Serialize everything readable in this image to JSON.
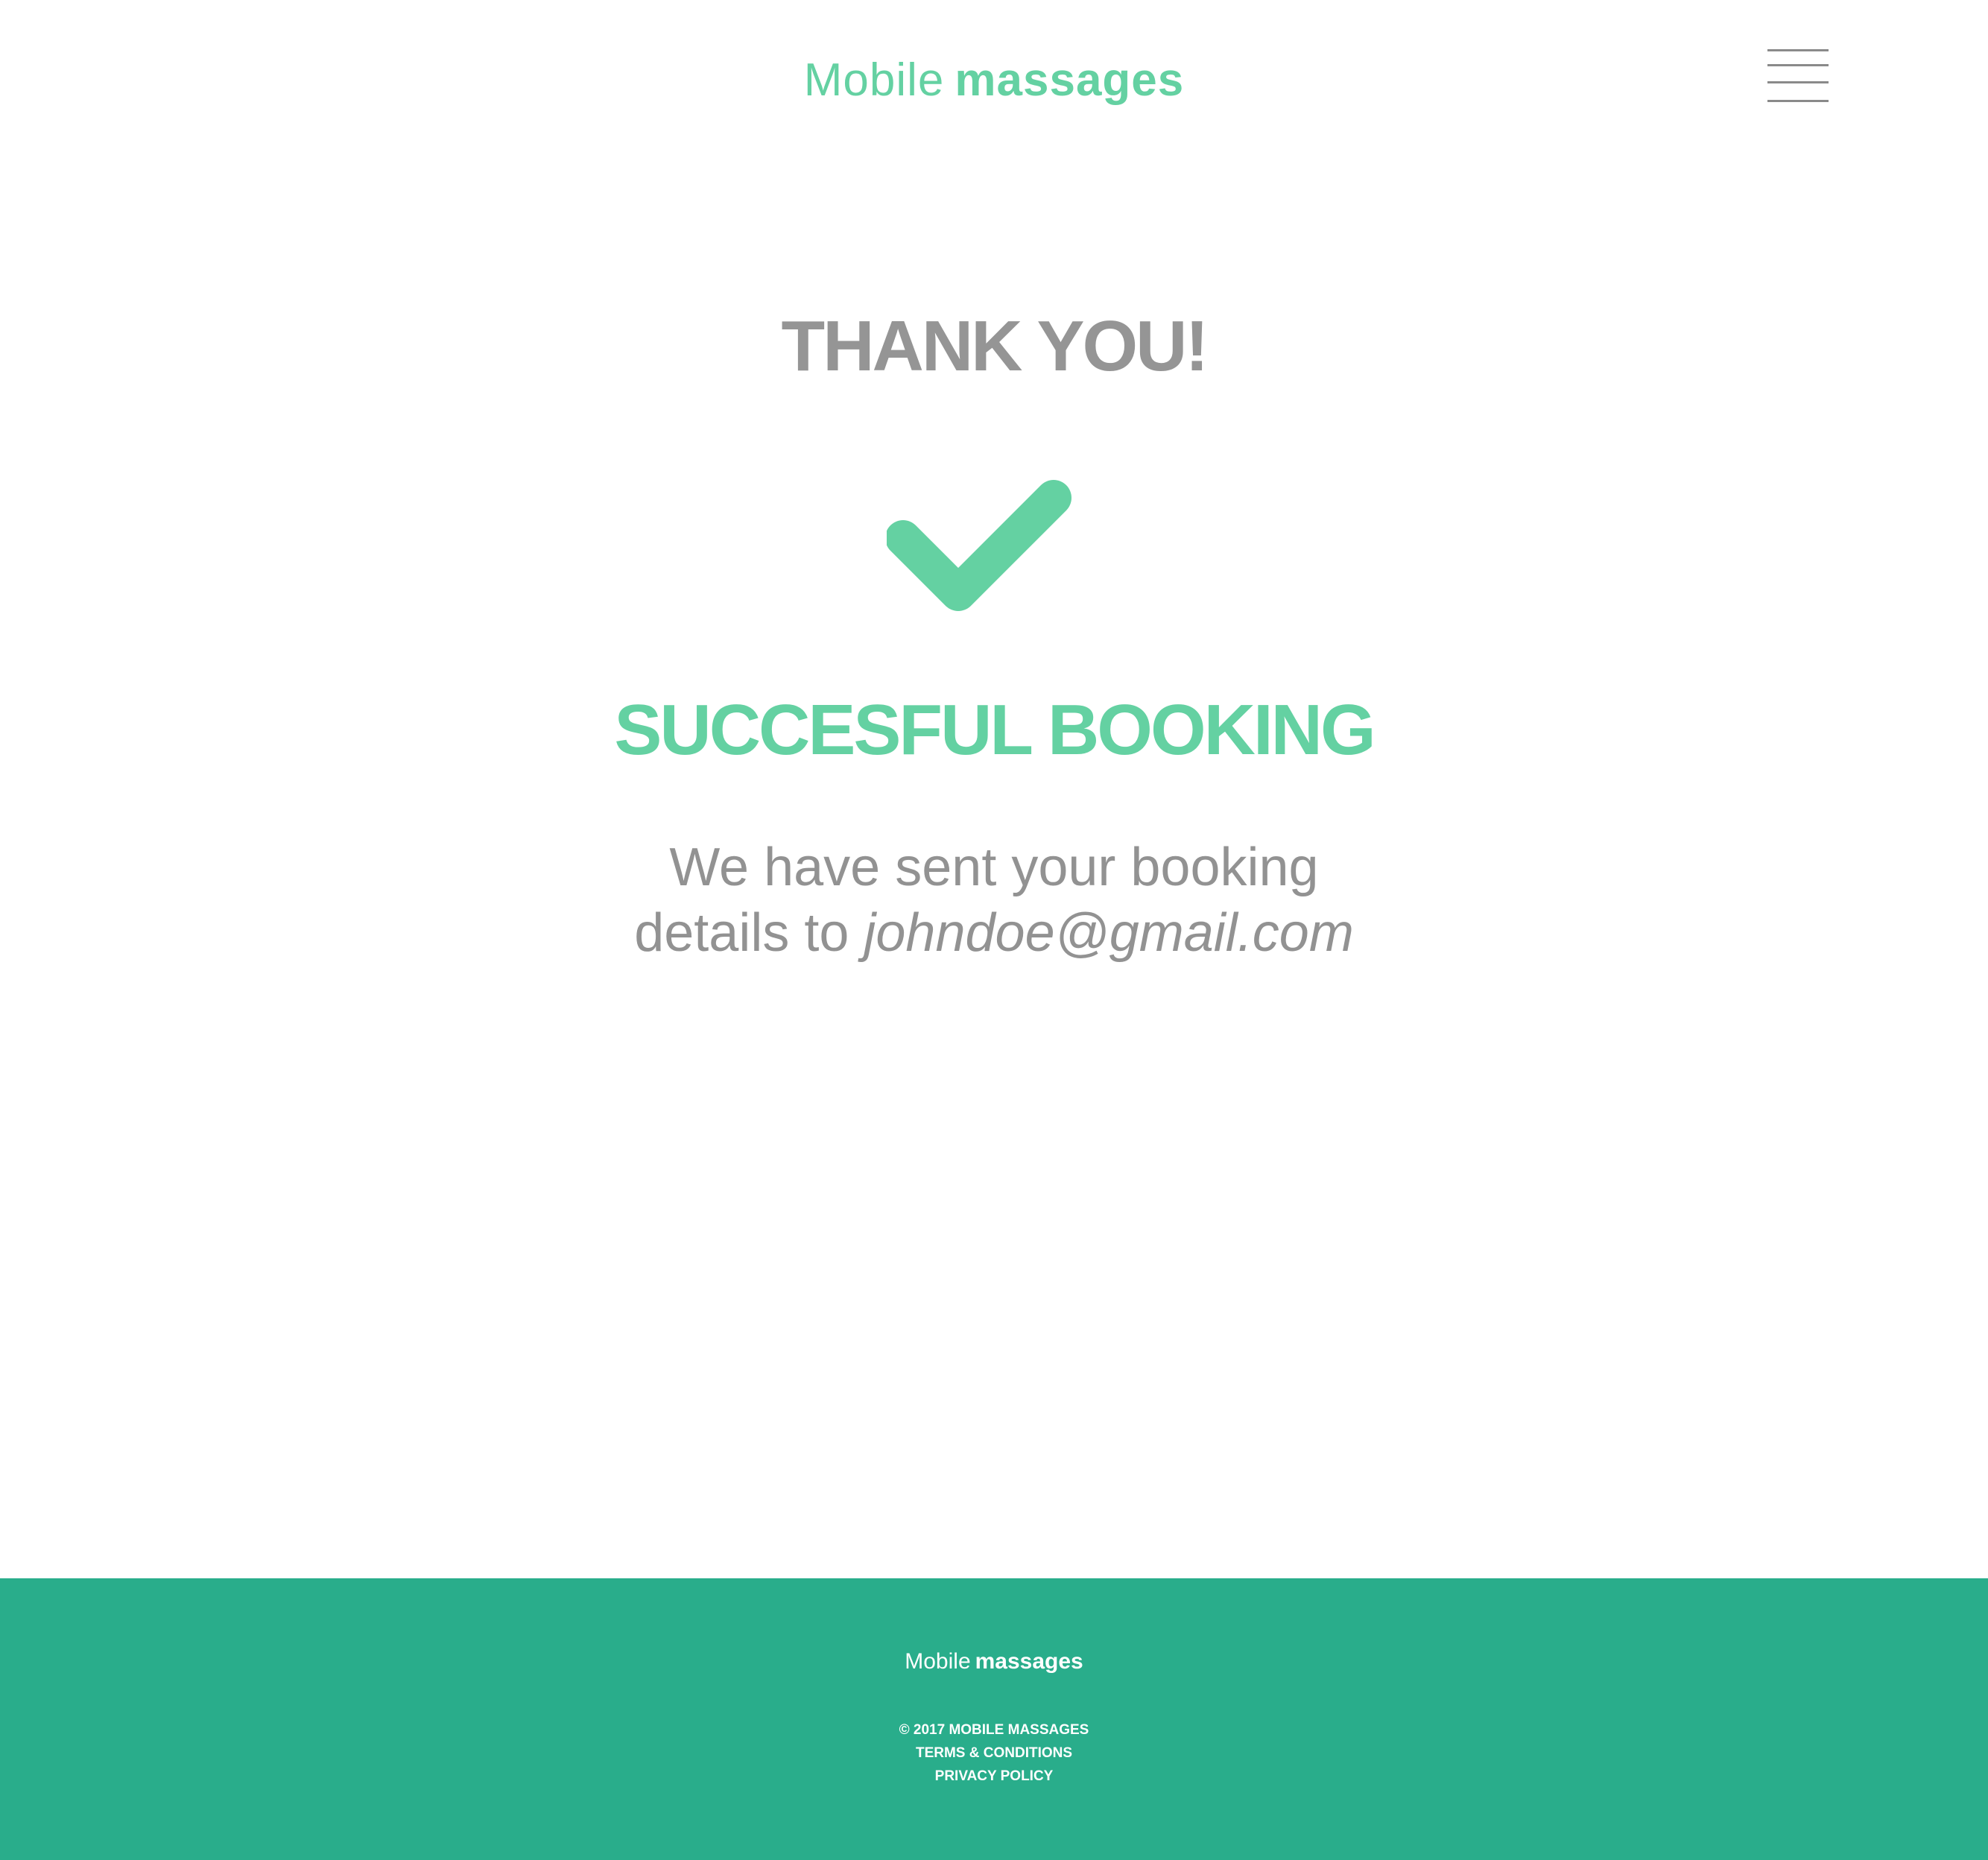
{
  "brand": {
    "light": "Mobile",
    "bold": "massages",
    "accent_color": "#64d1a2"
  },
  "header": {
    "menu_icon": "hamburger-menu-icon"
  },
  "main": {
    "heading": "THANK YOU!",
    "status_icon": "checkmark-icon",
    "status": "SUCCESFUL BOOKING",
    "message_line1": "We have sent your booking",
    "message_line2_prefix": "details to",
    "email": "johndoe@gmail.com"
  },
  "footer": {
    "background_color": "#29ad8b",
    "logo_light": "Mobile",
    "logo_bold": "massages",
    "copyright": "© 2017 MOBILE MASSAGES",
    "terms_label": "TERMS & CONDITIONS",
    "privacy_label": "PRIVACY POLICY"
  }
}
